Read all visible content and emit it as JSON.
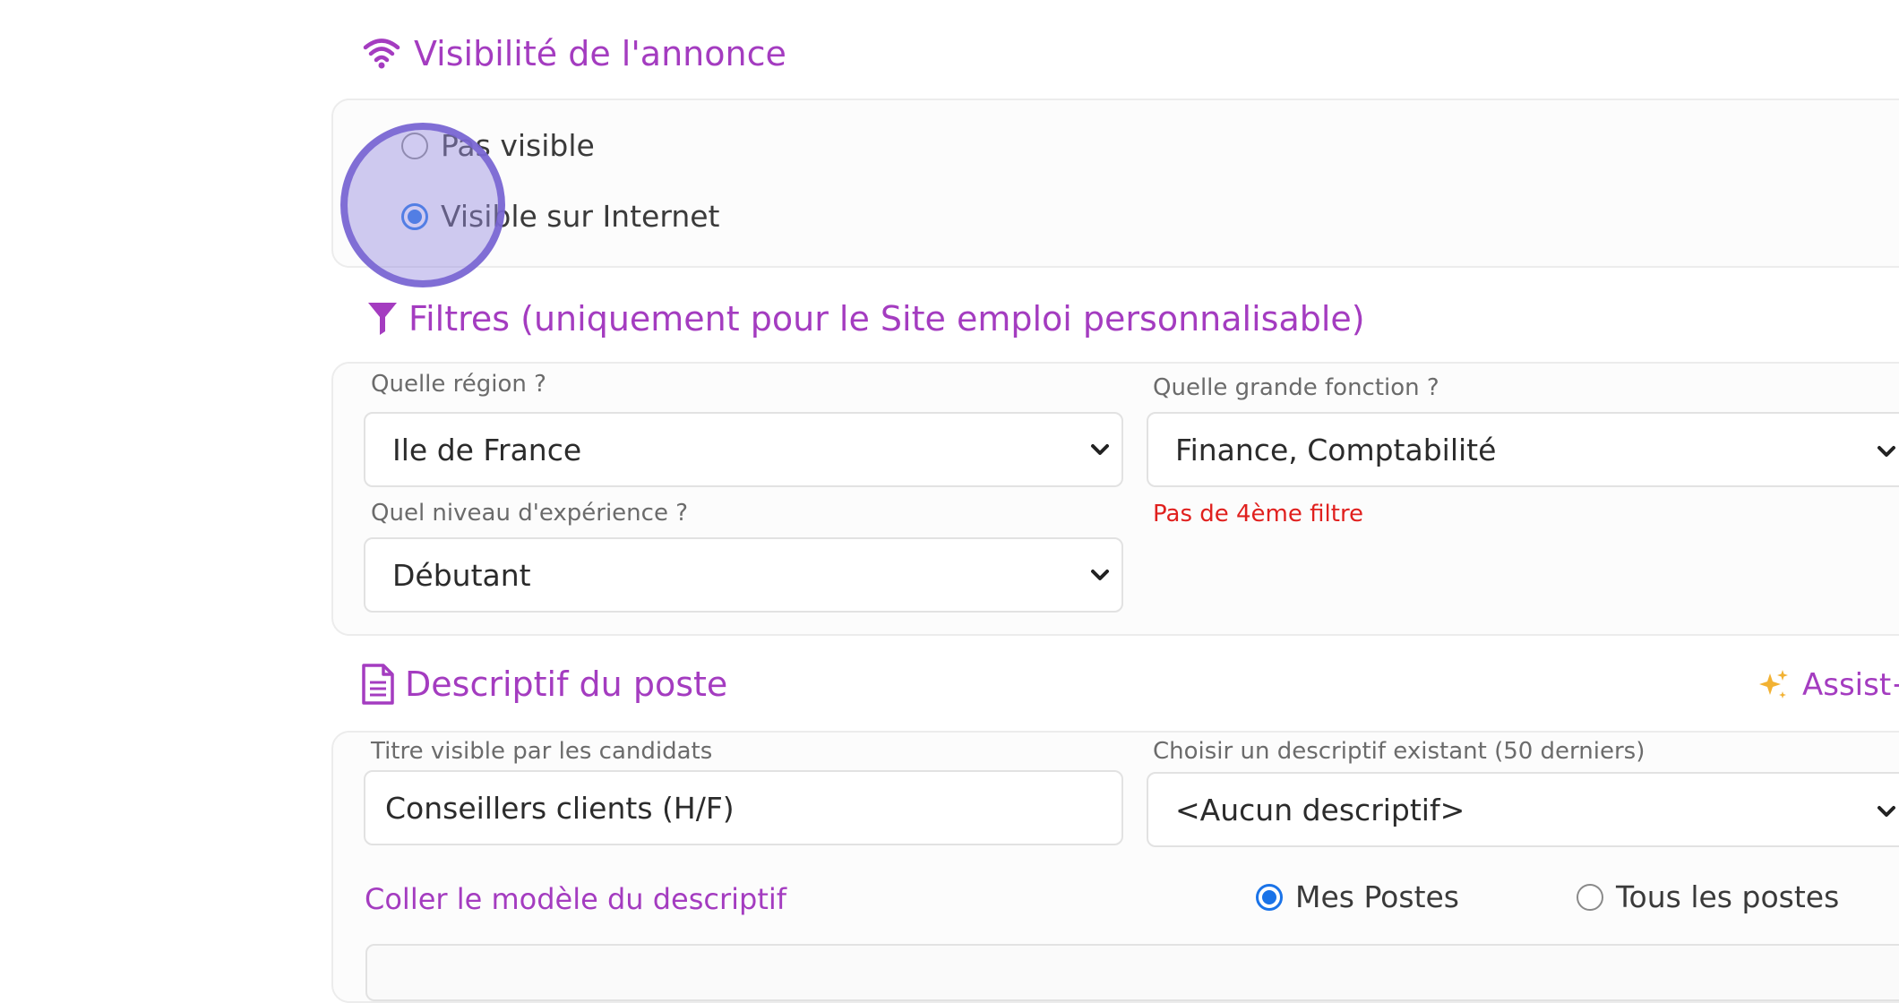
{
  "visibility": {
    "title": "Visibilité de l'annonce",
    "options": [
      {
        "label": "Pas visible",
        "checked": false
      },
      {
        "label": "Visible sur Internet",
        "checked": true
      }
    ]
  },
  "filters": {
    "title": "Filtres (uniquement pour le Site emploi personnalisable)",
    "region": {
      "label": "Quelle région ?",
      "value": "Ile de France"
    },
    "fonction": {
      "label": "Quelle grande fonction ?",
      "value": "Finance, Comptabilité"
    },
    "experience": {
      "label": "Quel niveau d'expérience ?",
      "value": "Débutant"
    },
    "warning": "Pas de 4ème filtre"
  },
  "description": {
    "title": "Descriptif du poste",
    "assist_label": "Assist+",
    "titre": {
      "label": "Titre visible par les candidats",
      "value": "Conseillers clients (H/F)"
    },
    "choix": {
      "label": "Choisir un descriptif existant (50 derniers)",
      "value": "<Aucun descriptif>"
    },
    "coller_label": "Coller le modèle du descriptif",
    "scope_options": [
      {
        "label": "Mes Postes",
        "checked": true
      },
      {
        "label": "Tous les postes",
        "checked": false
      }
    ]
  },
  "colors": {
    "accent": "#a43cc0",
    "radio": "#1a73e8",
    "warning": "#e0201e"
  }
}
